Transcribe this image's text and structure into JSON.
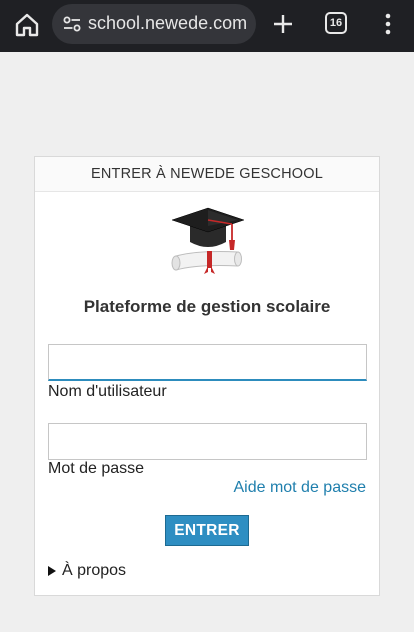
{
  "browser": {
    "url": "school.newede.com",
    "tab_count": "16",
    "icons": [
      "home-icon",
      "site-settings-icon",
      "new-tab-icon",
      "tab-switcher-icon",
      "menu-icon"
    ]
  },
  "login": {
    "header": "ENTRER À NEWEDE GESCHOOL",
    "subtitle": "Plateforme de gestion scolaire",
    "username_value": "",
    "username_label": "Nom d'utilisateur",
    "password_value": "",
    "password_label": "Mot de passe",
    "help_link": "Aide mot de passe",
    "submit_label": "ENTRER",
    "about_label": "À propos",
    "logo_icon": "graduation-cap-icon"
  },
  "colors": {
    "accent": "#2e8ec2",
    "link": "#1f7fad",
    "browser_bar": "#1f2024"
  }
}
